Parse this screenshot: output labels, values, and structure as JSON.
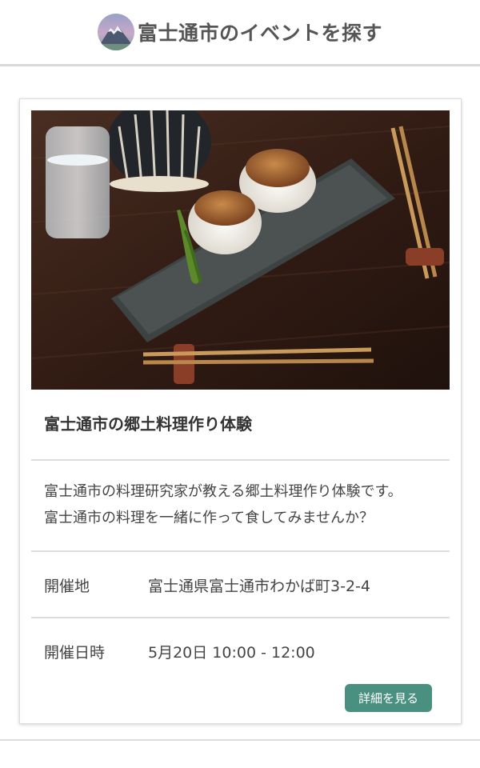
{
  "header": {
    "logo_icon": "mount-fuji-logo-icon",
    "title": "富士通市のイベントを探す"
  },
  "event": {
    "image_alt": "焼きおにぎりと箸の写真",
    "title": "富士通市の郷土料理作り体験",
    "description_lines": [
      "富士通市の料理研究家が教える郷土料理作り体験です。",
      "富士通市の料理を一緒に作って食してみませんか？"
    ],
    "location_label": "開催地",
    "location_value": "富士通県富士通市わかば町3-2-4",
    "datetime_label": "開催日時",
    "datetime_value": "5月20日 10:00 - 12:00",
    "detail_button_label": "詳細を見る"
  },
  "colors": {
    "accent": "#4a9080",
    "divider": "#dddddd",
    "title_text": "#555555"
  }
}
